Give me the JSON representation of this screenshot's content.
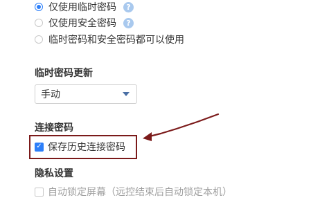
{
  "connection_mode": {
    "options": [
      {
        "label": "仅使用临时密码",
        "selected": true,
        "has_help": true
      },
      {
        "label": "仅使用安全密码",
        "selected": false,
        "has_help": true
      },
      {
        "label": "临时密码和安全密码都可以使用",
        "selected": false,
        "has_help": false
      }
    ],
    "help_glyph": "?"
  },
  "temp_password_update": {
    "title": "临时密码更新",
    "select_value": "手动"
  },
  "connection_password": {
    "title": "连接密码",
    "save_history_label": "保存历史连接密码",
    "save_history_checked": true
  },
  "privacy": {
    "title": "隐私设置",
    "auto_lock_label": "自动锁定屏幕（远控结束后自动锁定本机）",
    "auto_lock_checked": false
  },
  "colors": {
    "accent": "#2d7ff9",
    "annotation": "#7b1a1a"
  },
  "icons": {
    "help": "help-icon",
    "dropdown": "chevron-down-icon",
    "check": "check-icon"
  }
}
